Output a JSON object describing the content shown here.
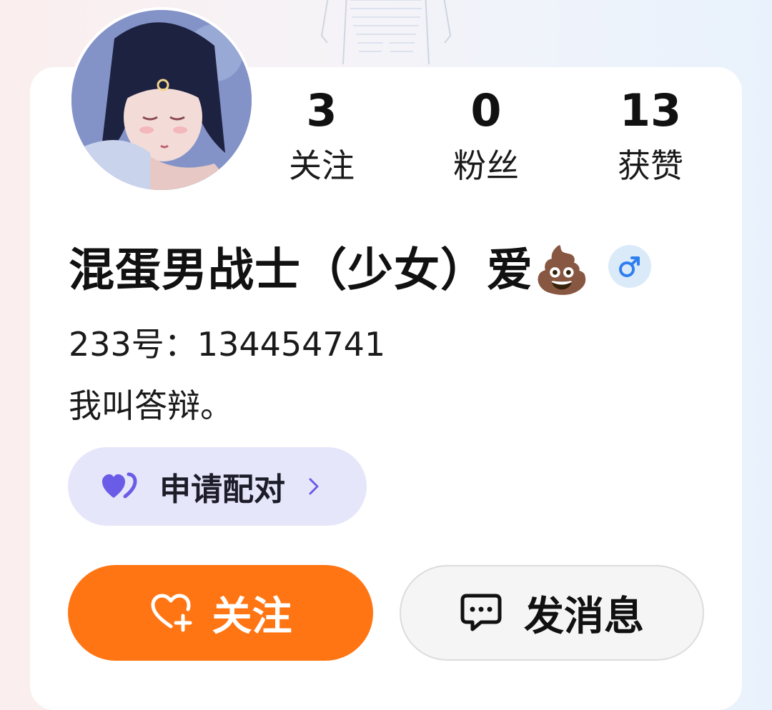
{
  "profile": {
    "stats": [
      {
        "value": "3",
        "label": "关注"
      },
      {
        "value": "0",
        "label": "粉丝"
      },
      {
        "value": "13",
        "label": "获赞"
      }
    ],
    "nickname": "混蛋男战士（少女）爱💩",
    "gender_icon": "male-icon",
    "id_line": "233号：134454741",
    "bio": "我叫答辩。"
  },
  "actions": {
    "pair_label": "申请配对",
    "pair_icon": "hearts-icon",
    "follow_label": "关注",
    "follow_icon": "heart-plus-icon",
    "message_label": "发消息",
    "message_icon": "chat-bubble-icon"
  },
  "colors": {
    "follow_button": "#ff7513",
    "pair_button_bg": "#e6e6fb",
    "pair_icon": "#6a5ce6",
    "gender_badge_bg": "#dbeaf9",
    "gender_icon": "#2f7ff0"
  }
}
